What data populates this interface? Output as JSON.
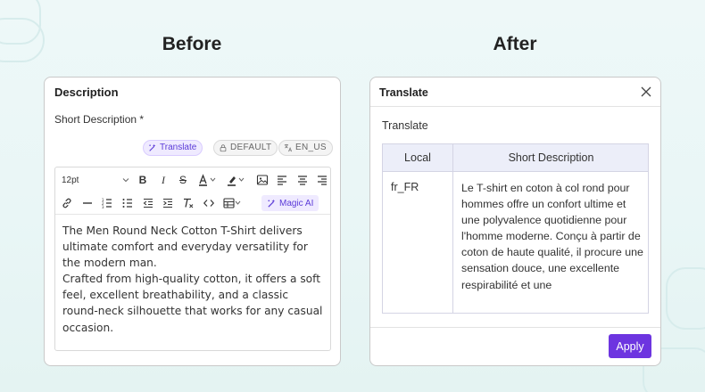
{
  "headings": {
    "before": "Before",
    "after": "After"
  },
  "before_panel": {
    "title": "Description",
    "field_label": "Short Description *",
    "chips": {
      "translate": "Translate",
      "default": "DEFAULT",
      "lang": "EN_US"
    },
    "toolbar": {
      "font_size": "12pt",
      "magic_ai": "Magic AI"
    },
    "content": [
      "The Men Round Neck Cotton T-Shirt delivers ultimate comfort and everyday versatility for the modern man.",
      "Crafted from high-quality cotton, it offers a soft feel, excellent breathability, and a classic round-neck silhouette that works for any casual occasion."
    ]
  },
  "after_panel": {
    "title": "Translate",
    "subtitle": "Translate",
    "columns": [
      "Local",
      "Short Description"
    ],
    "rows": [
      {
        "local": "fr_FR",
        "description": "Le T-shirt en coton à col rond pour hommes offre un confort ultime et une polyvalence quotidienne pour l'homme moderne. Conçu à partir de coton de haute qualité, il procure une sensation douce, une excellente respirabilité et une"
      }
    ],
    "apply_label": "Apply"
  },
  "colors": {
    "accent": "#6d35e0",
    "chip_bg": "#efeaff",
    "table_head": "#eceef9"
  }
}
